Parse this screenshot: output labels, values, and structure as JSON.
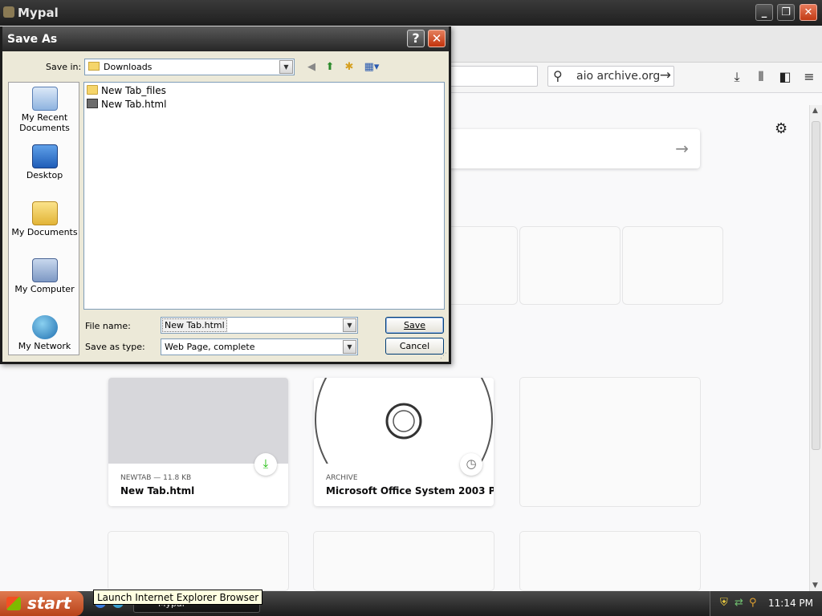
{
  "browser": {
    "title": "Mypal",
    "search_text": "aio archive.org"
  },
  "dialog": {
    "title": "Save As",
    "help_label": "?",
    "save_in_label": "Save in:",
    "save_in_value": "Downloads",
    "places": [
      "My Recent Documents",
      "Desktop",
      "My Documents",
      "My Computer",
      "My Network"
    ],
    "files": [
      {
        "name": "New Tab_files",
        "type": "folder"
      },
      {
        "name": "New Tab.html",
        "type": "html"
      }
    ],
    "file_name_label": "File name:",
    "file_name_value": "New Tab.html",
    "save_type_label": "Save as type:",
    "save_type_value": "Web Page, complete",
    "save_button": "Save",
    "cancel_button": "Cancel"
  },
  "newtab": {
    "cards": [
      {
        "context": "NEWTAB — 11.8 KB",
        "title": "New Tab.html",
        "badge": "download-icon"
      },
      {
        "context": "ARCHIVE",
        "title": "Microsoft Office System 2003 P...",
        "badge": "clock-icon"
      }
    ]
  },
  "taskbar": {
    "start_label": "start",
    "window_label": "Mypal",
    "tooltip": "Launch Internet Explorer Browser",
    "clock": "11:14 PM"
  }
}
